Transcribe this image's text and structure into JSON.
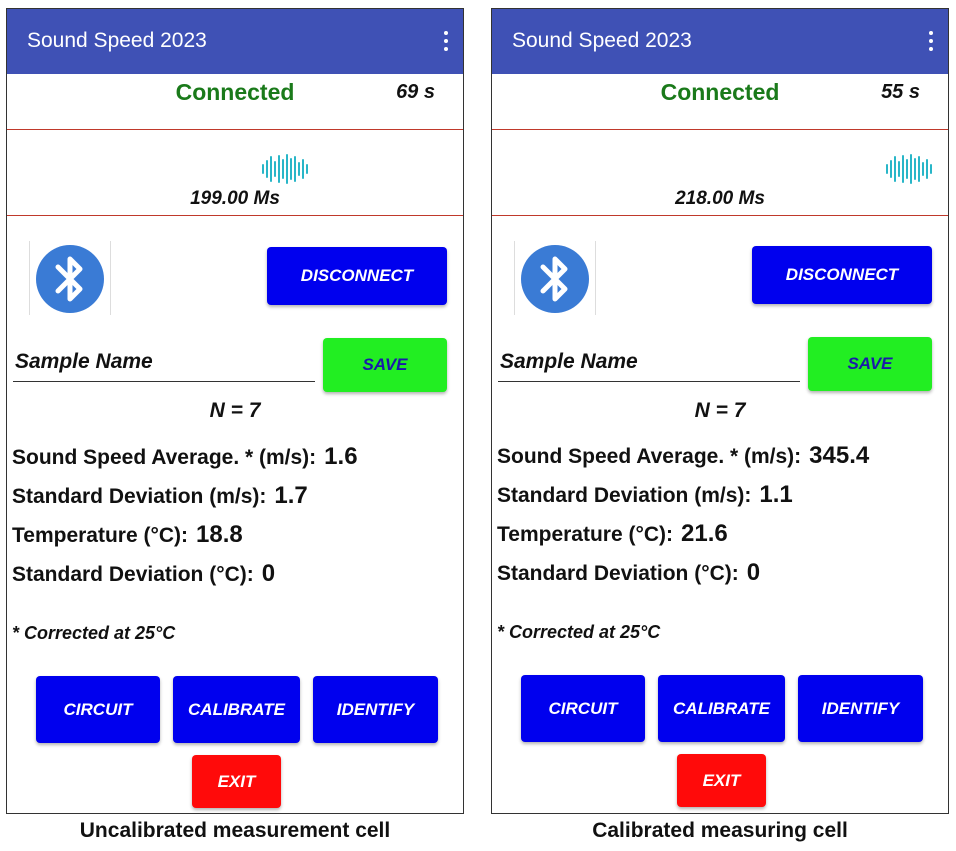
{
  "panels": [
    {
      "app_title": "Sound Speed 2023",
      "connection_status": "Connected",
      "elapsed_time": "69 s",
      "sample_rate": "199.00 Ms",
      "disconnect_label": "DISCONNECT",
      "sample_name_placeholder": "Sample Name",
      "save_label": "SAVE",
      "n_label": "N = 7",
      "speed_avg_label": "Sound Speed Average. * (m/s):",
      "speed_avg_value": "1.6",
      "speed_sd_label": "Standard Deviation (m/s):",
      "speed_sd_value": "1.7",
      "temp_label": "Temperature (°C):",
      "temp_value": "18.8",
      "temp_sd_label": "Standard Deviation (°C):",
      "temp_sd_value": "0",
      "correction_note": "* Corrected at 25°C",
      "circuit_label": "CIRCUIT",
      "calibrate_label": "CALIBRATE",
      "identify_label": "IDENTIFY",
      "exit_label": "EXIT",
      "caption": "Uncalibrated measurement cell"
    },
    {
      "app_title": "Sound Speed 2023",
      "connection_status": "Connected",
      "elapsed_time": "55 s",
      "sample_rate": "218.00 Ms",
      "disconnect_label": "DISCONNECT",
      "sample_name_placeholder": "Sample Name",
      "save_label": "SAVE",
      "n_label": "N = 7",
      "speed_avg_label": "Sound Speed Average. * (m/s):",
      "speed_avg_value": "345.4",
      "speed_sd_label": "Standard Deviation (m/s):",
      "speed_sd_value": "1.1",
      "temp_label": "Temperature (°C):",
      "temp_value": "21.6",
      "temp_sd_label": "Standard Deviation (°C):",
      "temp_sd_value": "0",
      "correction_note": "* Corrected at 25°C",
      "circuit_label": "CIRCUIT",
      "calibrate_label": "CALIBRATE",
      "identify_label": "IDENTIFY",
      "exit_label": "EXIT",
      "caption": "Calibrated measuring cell"
    }
  ],
  "icons": {
    "menu": "more-vert-icon",
    "signal": "sound-wave-icon",
    "bluetooth": "bluetooth-icon"
  },
  "colors": {
    "app_bar": "#3f51b5",
    "connected": "#1a7a1a",
    "primary_button": "#0000ee",
    "save_button": "#22ee22",
    "exit_button": "#ff0a0a",
    "divider": "#c0392b"
  }
}
